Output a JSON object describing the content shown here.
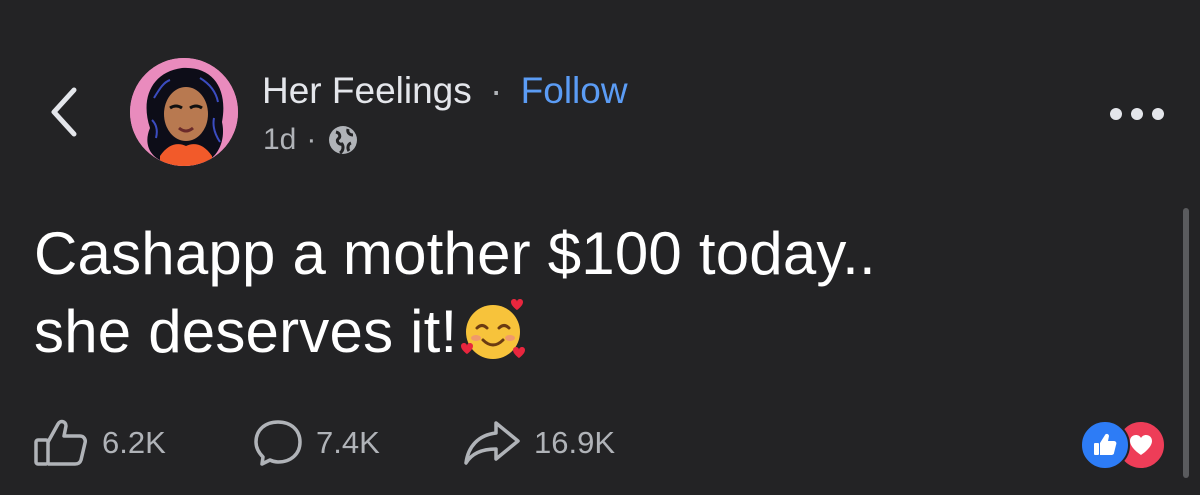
{
  "header": {
    "back_icon": "chevron-left-icon",
    "author_name": "Her Feelings",
    "separator": "·",
    "follow_label": "Follow",
    "timestamp": "1d",
    "meta_separator": "·",
    "privacy_icon": "globe-icon",
    "more_icon": "more-horizontal-icon"
  },
  "post": {
    "text_line1": "Cashapp a mother $100 today..",
    "text_line2": "she deserves it!",
    "emoji": "smiling-face-with-hearts-emoji"
  },
  "actions": {
    "likes": "6.2K",
    "comments": "7.4K",
    "shares": "16.9K"
  },
  "reactions": [
    "like",
    "love"
  ],
  "colors": {
    "background": "#232325",
    "accent": "#5b9cf5",
    "like": "#2d7cf6",
    "love": "#ee3d58"
  }
}
